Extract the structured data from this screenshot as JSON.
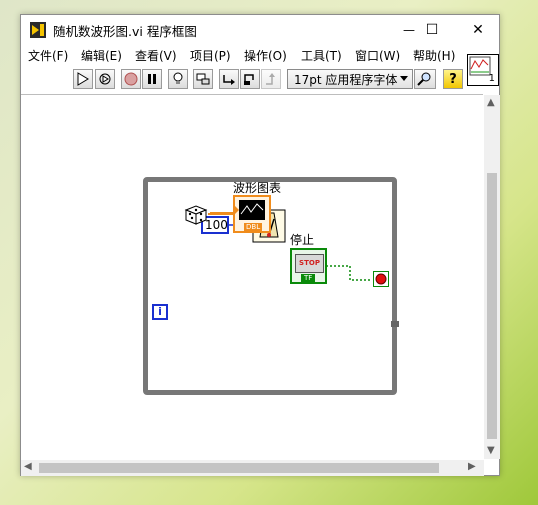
{
  "window": {
    "title": "随机数波形图.vi 程序框图",
    "minimize_symbol": "—",
    "maximize_symbol": "☐",
    "close_symbol": "✕"
  },
  "menu": {
    "items": [
      "文件(F)",
      "编辑(E)",
      "查看(V)",
      "项目(P)",
      "操作(O)",
      "工具(T)",
      "窗口(W)",
      "帮助(H)"
    ]
  },
  "toolbar": {
    "font": "17pt 应用程序字体",
    "help_glyph": "?"
  },
  "context_help": {
    "number": "1"
  },
  "diagram": {
    "constant_value": "100",
    "waveform_chart_label": "波形图表",
    "stop_label": "停止",
    "stop_button_text": "STOP",
    "stop_terminal_type": "TF",
    "chart_terminal_type": "DBL",
    "loop_iteration": "i"
  },
  "colors": {
    "numeric_wire": "#f08c1c",
    "integer_wire": "#1a30d0",
    "boolean_wire": "#0a8a0a",
    "loop_border": "#777777"
  }
}
